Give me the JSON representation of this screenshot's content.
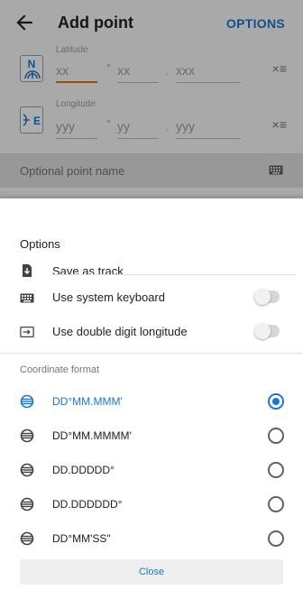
{
  "appbar": {
    "title": "Add point",
    "options_label": "OPTIONS"
  },
  "latitude": {
    "badge": "N",
    "label": "Latitude",
    "degrees_placeholder": "xx",
    "minutes_placeholder": "xx",
    "fraction_placeholder": "xxx",
    "degree_symbol": "°",
    "dot": "."
  },
  "longitude": {
    "badge": "E",
    "label": "Longitude",
    "degrees_placeholder": "yyy",
    "minutes_placeholder": "yy",
    "fraction_placeholder": "yyy",
    "degree_symbol": "°",
    "dot": "."
  },
  "clear_glyph": "×≡",
  "point_name": {
    "placeholder": "Optional point name"
  },
  "sheet": {
    "title": "Options",
    "items": [
      {
        "label": "Save as track",
        "icon": "save-track-icon"
      },
      {
        "label": "Use system keyboard",
        "icon": "keyboard-icon",
        "toggle": false
      },
      {
        "label": "Use double digit longitude",
        "icon": "arrow-into-box-icon",
        "toggle": false
      }
    ],
    "section_title": "Coordinate format",
    "formats": [
      {
        "label": "DD°MM.MMM'",
        "selected": true
      },
      {
        "label": "DD°MM.MMMM'",
        "selected": false
      },
      {
        "label": "DD.DDDDD°",
        "selected": false
      },
      {
        "label": "DD.DDDDDD°",
        "selected": false
      },
      {
        "label": "DD°MM'SS\"",
        "selected": false
      }
    ],
    "close_label": "Close"
  },
  "colors": {
    "accent": "#1976d2",
    "focus": "#ef6c00",
    "scrim": "rgba(0,0,0,0.32)"
  }
}
